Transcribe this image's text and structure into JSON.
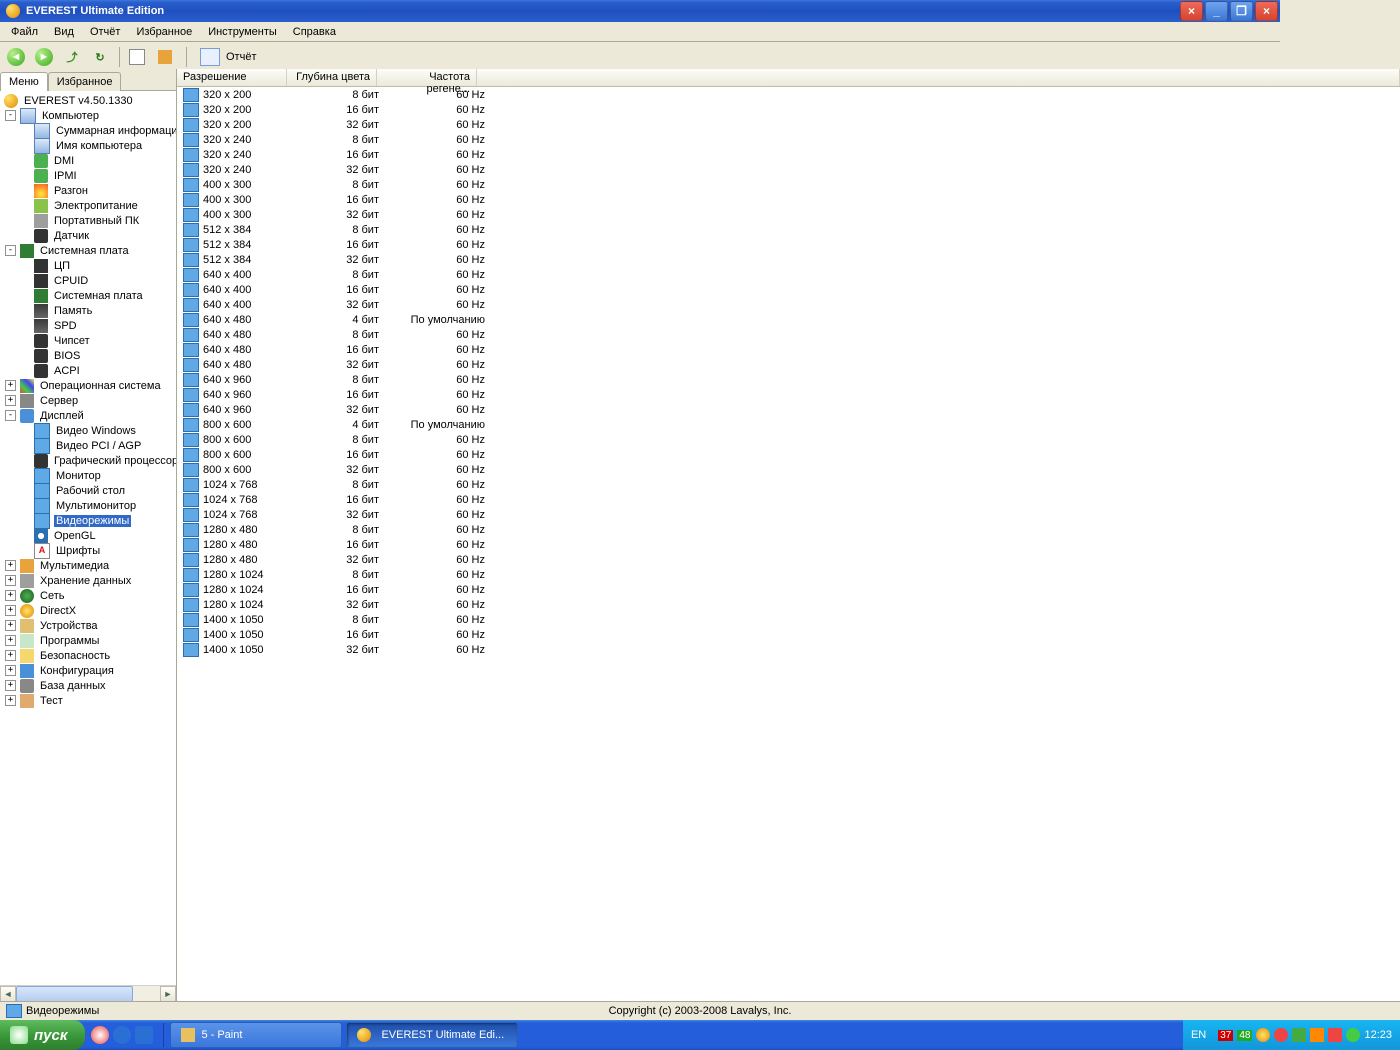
{
  "title": "EVEREST Ultimate Edition",
  "menus": [
    "Файл",
    "Вид",
    "Отчёт",
    "Избранное",
    "Инструменты",
    "Справка"
  ],
  "report_label": "Отчёт",
  "tabs": {
    "menu": "Меню",
    "fav": "Избранное"
  },
  "tree": [
    {
      "lvl": 0,
      "icon": "ti-ev",
      "label": "EVEREST v4.50.1330"
    },
    {
      "lvl": 1,
      "exp": "-",
      "icon": "ti-comp",
      "label": "Компьютер"
    },
    {
      "lvl": 2,
      "icon": "ti-comp",
      "label": "Суммарная информация"
    },
    {
      "lvl": 2,
      "icon": "ti-comp",
      "label": "Имя компьютера"
    },
    {
      "lvl": 2,
      "icon": "ti-card",
      "label": "DMI"
    },
    {
      "lvl": 2,
      "icon": "ti-card",
      "label": "IPMI"
    },
    {
      "lvl": 2,
      "icon": "ti-fire",
      "label": "Разгон"
    },
    {
      "lvl": 2,
      "icon": "ti-plug",
      "label": "Электропитание"
    },
    {
      "lvl": 2,
      "icon": "ti-batt",
      "label": "Портативный ПК"
    },
    {
      "lvl": 2,
      "icon": "ti-chip",
      "label": "Датчик"
    },
    {
      "lvl": 1,
      "exp": "-",
      "icon": "ti-mb",
      "label": "Системная плата"
    },
    {
      "lvl": 2,
      "icon": "ti-cpu",
      "label": "ЦП"
    },
    {
      "lvl": 2,
      "icon": "ti-cpu",
      "label": "CPUID"
    },
    {
      "lvl": 2,
      "icon": "ti-mb",
      "label": "Системная плата"
    },
    {
      "lvl": 2,
      "icon": "ti-ram",
      "label": "Память"
    },
    {
      "lvl": 2,
      "icon": "ti-ram",
      "label": "SPD"
    },
    {
      "lvl": 2,
      "icon": "ti-chip",
      "label": "Чипсет"
    },
    {
      "lvl": 2,
      "icon": "ti-chip",
      "label": "BIOS"
    },
    {
      "lvl": 2,
      "icon": "ti-chip",
      "label": "ACPI"
    },
    {
      "lvl": 1,
      "exp": "+",
      "icon": "ti-win",
      "label": "Операционная система"
    },
    {
      "lvl": 1,
      "exp": "+",
      "icon": "ti-srv",
      "label": "Сервер"
    },
    {
      "lvl": 1,
      "exp": "-",
      "icon": "ti-disp",
      "label": "Дисплей"
    },
    {
      "lvl": 2,
      "icon": "ti-mon",
      "label": "Видео Windows"
    },
    {
      "lvl": 2,
      "icon": "ti-mon",
      "label": "Видео PCI / AGP"
    },
    {
      "lvl": 2,
      "icon": "ti-chip",
      "label": "Графический процессор"
    },
    {
      "lvl": 2,
      "icon": "ti-mon",
      "label": "Монитор"
    },
    {
      "lvl": 2,
      "icon": "ti-mon",
      "label": "Рабочий стол"
    },
    {
      "lvl": 2,
      "icon": "ti-mon",
      "label": "Мультимонитор"
    },
    {
      "lvl": 2,
      "icon": "ti-mon",
      "label": "Видеорежимы",
      "sel": true
    },
    {
      "lvl": 2,
      "icon": "ti-gl",
      "label": "OpenGL"
    },
    {
      "lvl": 2,
      "icon": "ti-font",
      "label": "Шрифты",
      "txt": "A"
    },
    {
      "lvl": 1,
      "exp": "+",
      "icon": "ti-mm",
      "label": "Мультимедиа"
    },
    {
      "lvl": 1,
      "exp": "+",
      "icon": "ti-store",
      "label": "Хранение данных"
    },
    {
      "lvl": 1,
      "exp": "+",
      "icon": "ti-net",
      "label": "Сеть"
    },
    {
      "lvl": 1,
      "exp": "+",
      "icon": "ti-dx",
      "label": "DirectX"
    },
    {
      "lvl": 1,
      "exp": "+",
      "icon": "ti-dev",
      "label": "Устройства"
    },
    {
      "lvl": 1,
      "exp": "+",
      "icon": "ti-prog",
      "label": "Программы"
    },
    {
      "lvl": 1,
      "exp": "+",
      "icon": "ti-sec",
      "label": "Безопасность"
    },
    {
      "lvl": 1,
      "exp": "+",
      "icon": "ti-cfg",
      "label": "Конфигурация"
    },
    {
      "lvl": 1,
      "exp": "+",
      "icon": "ti-db",
      "label": "База данных"
    },
    {
      "lvl": 1,
      "exp": "+",
      "icon": "ti-test",
      "label": "Тест"
    }
  ],
  "columns": {
    "c1": "Разрешение",
    "c2": "Глубина цвета",
    "c3": "Частота регене..."
  },
  "rows": [
    [
      "320 x 200",
      "8 бит",
      "60 Hz"
    ],
    [
      "320 x 200",
      "16 бит",
      "60 Hz"
    ],
    [
      "320 x 200",
      "32 бит",
      "60 Hz"
    ],
    [
      "320 x 240",
      "8 бит",
      "60 Hz"
    ],
    [
      "320 x 240",
      "16 бит",
      "60 Hz"
    ],
    [
      "320 x 240",
      "32 бит",
      "60 Hz"
    ],
    [
      "400 x 300",
      "8 бит",
      "60 Hz"
    ],
    [
      "400 x 300",
      "16 бит",
      "60 Hz"
    ],
    [
      "400 x 300",
      "32 бит",
      "60 Hz"
    ],
    [
      "512 x 384",
      "8 бит",
      "60 Hz"
    ],
    [
      "512 x 384",
      "16 бит",
      "60 Hz"
    ],
    [
      "512 x 384",
      "32 бит",
      "60 Hz"
    ],
    [
      "640 x 400",
      "8 бит",
      "60 Hz"
    ],
    [
      "640 x 400",
      "16 бит",
      "60 Hz"
    ],
    [
      "640 x 400",
      "32 бит",
      "60 Hz"
    ],
    [
      "640 x 480",
      "4 бит",
      "По умолчанию"
    ],
    [
      "640 x 480",
      "8 бит",
      "60 Hz"
    ],
    [
      "640 x 480",
      "16 бит",
      "60 Hz"
    ],
    [
      "640 x 480",
      "32 бит",
      "60 Hz"
    ],
    [
      "640 x 960",
      "8 бит",
      "60 Hz"
    ],
    [
      "640 x 960",
      "16 бит",
      "60 Hz"
    ],
    [
      "640 x 960",
      "32 бит",
      "60 Hz"
    ],
    [
      "800 x 600",
      "4 бит",
      "По умолчанию"
    ],
    [
      "800 x 600",
      "8 бит",
      "60 Hz"
    ],
    [
      "800 x 600",
      "16 бит",
      "60 Hz"
    ],
    [
      "800 x 600",
      "32 бит",
      "60 Hz"
    ],
    [
      "1024 x 768",
      "8 бит",
      "60 Hz"
    ],
    [
      "1024 x 768",
      "16 бит",
      "60 Hz"
    ],
    [
      "1024 x 768",
      "32 бит",
      "60 Hz"
    ],
    [
      "1280 x 480",
      "8 бит",
      "60 Hz"
    ],
    [
      "1280 x 480",
      "16 бит",
      "60 Hz"
    ],
    [
      "1280 x 480",
      "32 бит",
      "60 Hz"
    ],
    [
      "1280 x 1024",
      "8 бит",
      "60 Hz"
    ],
    [
      "1280 x 1024",
      "16 бит",
      "60 Hz"
    ],
    [
      "1280 x 1024",
      "32 бит",
      "60 Hz"
    ],
    [
      "1400 x 1050",
      "8 бит",
      "60 Hz"
    ],
    [
      "1400 x 1050",
      "16 бит",
      "60 Hz"
    ],
    [
      "1400 x 1050",
      "32 бит",
      "60 Hz"
    ]
  ],
  "status": {
    "label": "Видеорежимы",
    "copy": "Copyright (c) 2003-2008 Lavalys, Inc."
  },
  "taskbar": {
    "start": "пуск",
    "tasks": [
      {
        "label": "5 - Paint"
      },
      {
        "label": "EVEREST Ultimate Edi...",
        "active": true
      }
    ],
    "lang": "EN",
    "badge1": "37",
    "badge2": "48",
    "clock": "12:23"
  }
}
